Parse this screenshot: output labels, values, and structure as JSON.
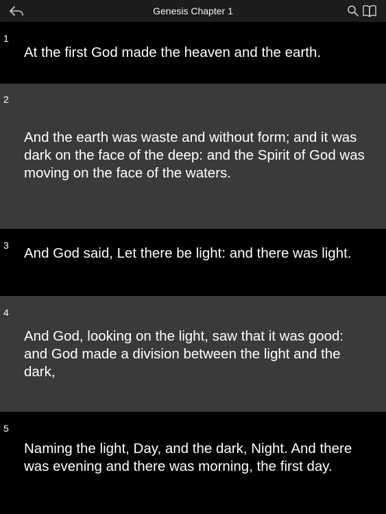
{
  "header": {
    "title": "Genesis Chapter 1",
    "icons": [
      "back-arrow-icon",
      "search-icon",
      "book-icon"
    ]
  },
  "colors": {
    "background": "#000000",
    "alt_row": "#3a3a3c",
    "header_bg": "#1c1c1e",
    "text": "#ffffff"
  },
  "verses": [
    {
      "number": "1",
      "text": "At the first God made the heaven and the earth."
    },
    {
      "number": "2",
      "text": "And the earth was waste and without form; and it was dark on the face of the deep: and the Spirit of God was moving on the face of the waters."
    },
    {
      "number": "3",
      "text": "And God said, Let there be light: and there was light."
    },
    {
      "number": "4",
      "text": "And God, looking on the light, saw that it was good: and God made a division between the light and the dark,"
    },
    {
      "number": "5",
      "text": "Naming the light, Day, and the dark, Night. And there was evening and there was morning, the first day."
    }
  ]
}
